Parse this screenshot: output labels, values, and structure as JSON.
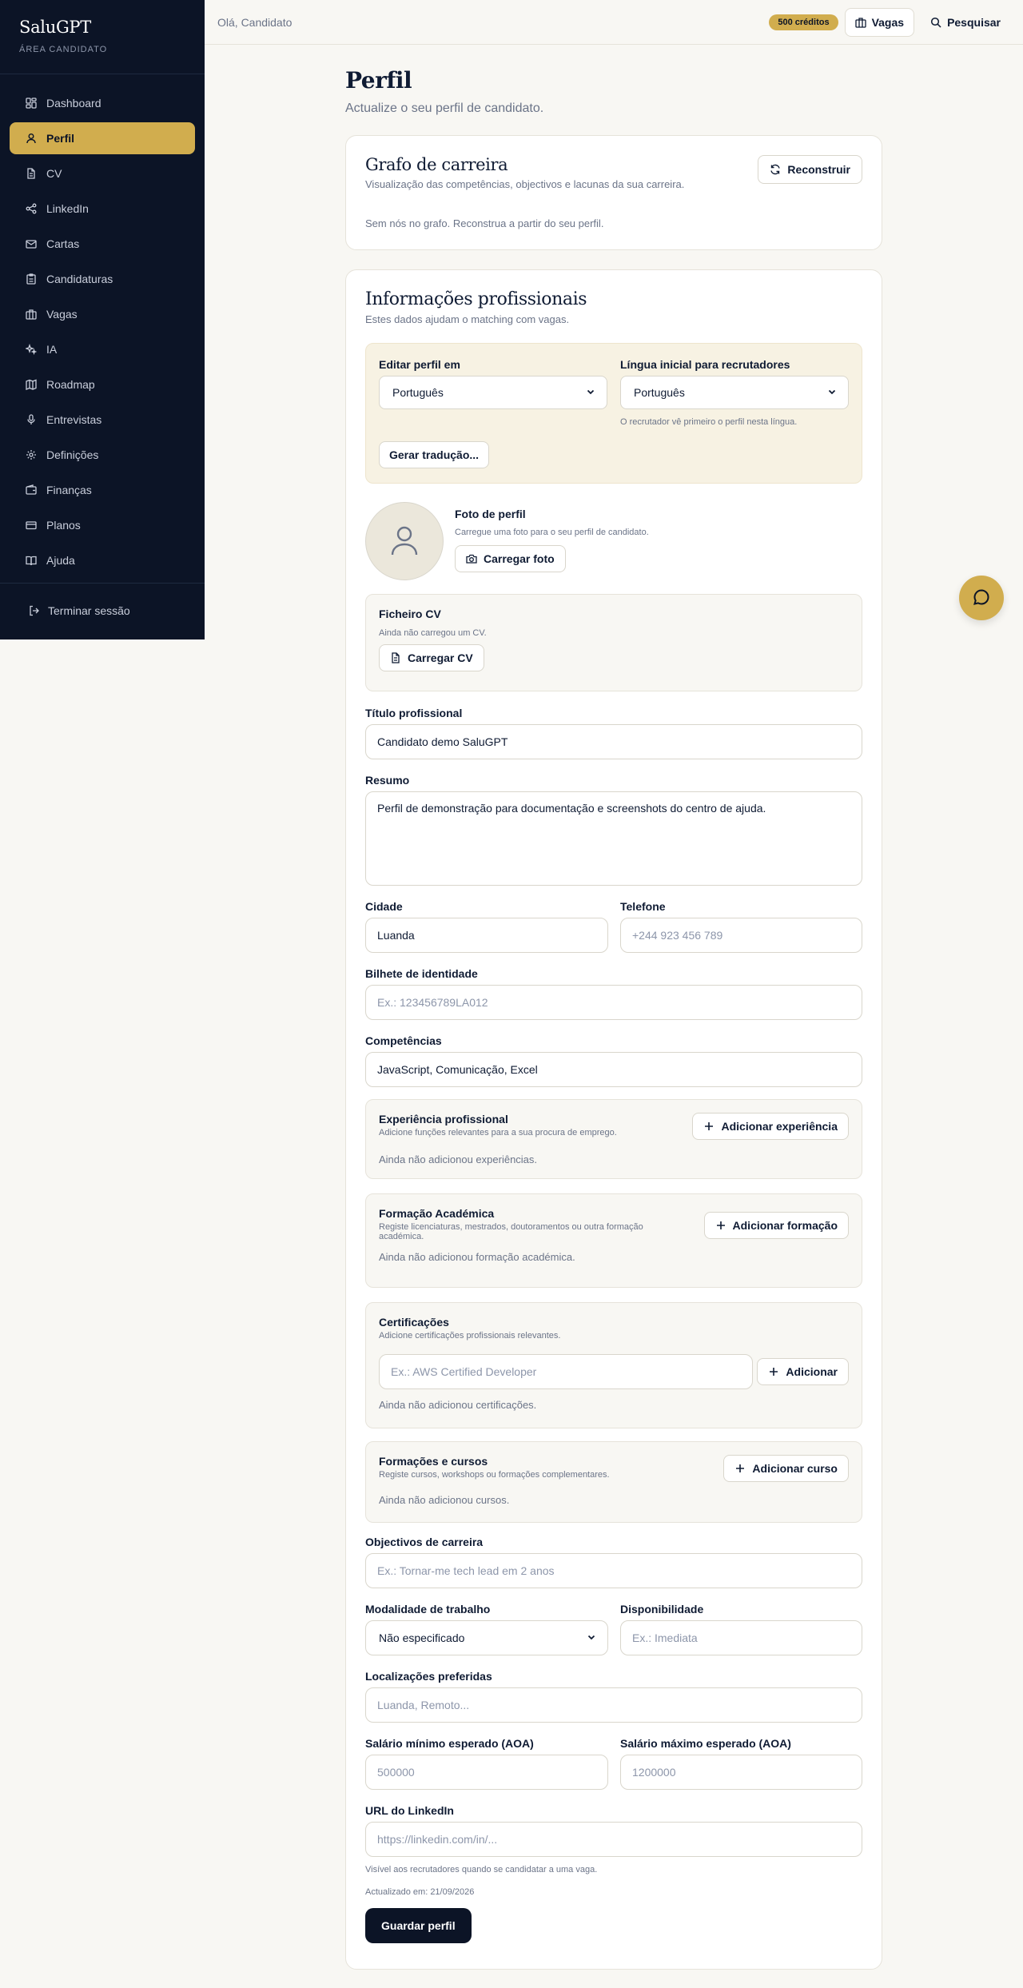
{
  "sidebar": {
    "brand": "SaluGPT",
    "subtitle": "ÁREA CANDIDATO",
    "items": [
      {
        "label": "Dashboard",
        "icon": "dashboard-icon"
      },
      {
        "label": "Perfil",
        "icon": "user-icon",
        "active": true
      },
      {
        "label": "CV",
        "icon": "file-icon"
      },
      {
        "label": "LinkedIn",
        "icon": "share-icon"
      },
      {
        "label": "Cartas",
        "icon": "mail-icon"
      },
      {
        "label": "Candidaturas",
        "icon": "clipboard-icon"
      },
      {
        "label": "Vagas",
        "icon": "briefcase-icon"
      },
      {
        "label": "IA",
        "icon": "sparkles-icon"
      },
      {
        "label": "Roadmap",
        "icon": "map-icon"
      },
      {
        "label": "Entrevistas",
        "icon": "mic-icon"
      },
      {
        "label": "Definições",
        "icon": "gear-icon"
      },
      {
        "label": "Finanças",
        "icon": "wallet-icon"
      },
      {
        "label": "Planos",
        "icon": "credit-card-icon"
      },
      {
        "label": "Ajuda",
        "icon": "book-icon"
      }
    ],
    "logout": "Terminar sessão"
  },
  "topbar": {
    "greeting": "Olá, Candidato",
    "credits": "500 créditos",
    "jobs_button": "Vagas",
    "search": "Pesquisar"
  },
  "page": {
    "title": "Perfil",
    "subtitle": "Actualize o seu perfil de candidato."
  },
  "graph": {
    "title": "Grafo de carreira",
    "subtitle": "Visualização das competências, objectivos e lacunas da sua carreira.",
    "rebuild": "Reconstruir",
    "empty": "Sem nós no grafo. Reconstrua a partir do seu perfil."
  },
  "profile": {
    "title": "Informações profissionais",
    "subtitle": "Estes dados ajudam o matching com vagas.",
    "edit_lang_label": "Editar perfil em",
    "edit_lang_value": "Português",
    "recruiter_lang_label": "Língua inicial para recrutadores",
    "recruiter_lang_value": "Português",
    "recruiter_lang_hint": "O recrutador vê primeiro o perfil nesta língua.",
    "translate_button": "Gerar tradução...",
    "photo_title": "Foto de perfil",
    "photo_hint": "Carregue uma foto para o seu perfil de candidato.",
    "photo_button": "Carregar foto",
    "cv_title": "Ficheiro CV",
    "cv_hint": "Ainda não carregou um CV.",
    "cv_button": "Carregar CV",
    "job_title_label": "Título profissional",
    "job_title_value": "Candidato demo SaluGPT",
    "summary_label": "Resumo",
    "summary_value": "Perfil de demonstração para documentação e screenshots do centro de ajuda.",
    "city_label": "Cidade",
    "city_value": "Luanda",
    "phone_label": "Telefone",
    "phone_placeholder": "+244 923 456 789",
    "id_label": "Bilhete de identidade",
    "id_placeholder": "Ex.: 123456789LA012",
    "skills_label": "Competências",
    "skills_value": "JavaScript, Comunicação, Excel",
    "experience": {
      "title": "Experiência profissional",
      "desc": "Adicione funções relevantes para a sua procura de emprego.",
      "button": "Adicionar experiência",
      "empty": "Ainda não adicionou experiências."
    },
    "education": {
      "title": "Formação Académica",
      "desc": "Registe licenciaturas, mestrados, doutoramentos ou outra formação académica.",
      "button": "Adicionar formação",
      "empty": "Ainda não adicionou formação académica."
    },
    "certifications": {
      "title": "Certificações",
      "desc": "Adicione certificações profissionais relevantes.",
      "placeholder": "Ex.: AWS Certified Developer",
      "button": "Adicionar",
      "empty": "Ainda não adicionou certificações."
    },
    "courses": {
      "title": "Formações e cursos",
      "desc": "Registe cursos, workshops ou formações complementares.",
      "button": "Adicionar curso",
      "empty": "Ainda não adicionou cursos."
    },
    "goals_label": "Objectivos de carreira",
    "goals_placeholder": "Ex.: Tornar-me tech lead em 2 anos",
    "work_mode_label": "Modalidade de trabalho",
    "work_mode_value": "Não especificado",
    "availability_label": "Disponibilidade",
    "availability_placeholder": "Ex.: Imediata",
    "locations_label": "Localizações preferidas",
    "locations_placeholder": "Luanda, Remoto...",
    "salary_min_label": "Salário mínimo esperado (AOA)",
    "salary_min_placeholder": "500000",
    "salary_max_label": "Salário máximo esperado (AOA)",
    "salary_max_placeholder": "1200000",
    "linkedin_label": "URL do LinkedIn",
    "linkedin_placeholder": "https://linkedin.com/in/...",
    "linkedin_hint": "Visível aos recrutadores quando se candidatar a uma vaga.",
    "updated": "Actualizado em: 21/09/2026",
    "save_button": "Guardar perfil"
  },
  "colors": {
    "sidebar_bg": "#0c1426",
    "accent": "#d1ad4e",
    "page_bg": "#f8f7f3"
  }
}
